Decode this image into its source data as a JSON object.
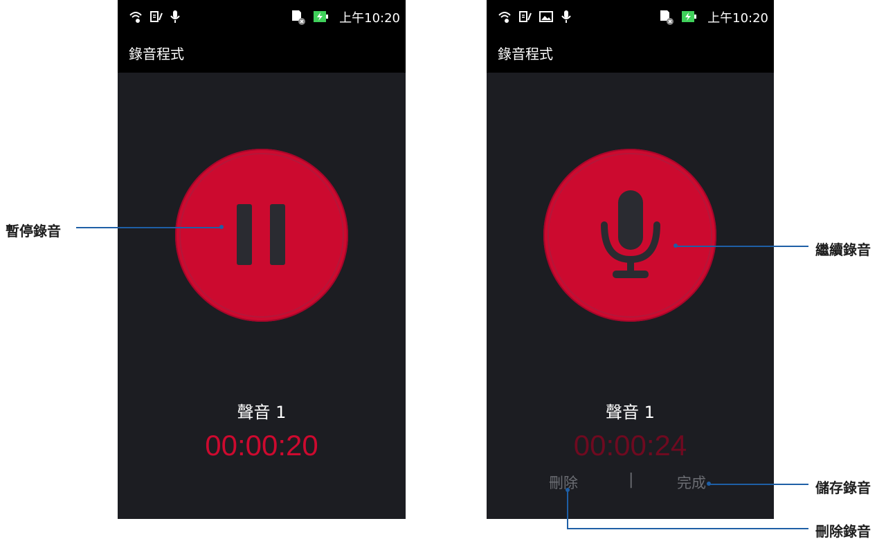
{
  "left_phone": {
    "status_time": "上午10:20",
    "app_title": "錄音程式",
    "recording_name": "聲音 1",
    "timer": "00:00:20"
  },
  "right_phone": {
    "status_time": "上午10:20",
    "app_title": "錄音程式",
    "recording_name": "聲音 1",
    "timer": "00:00:24",
    "delete_label": "刪除",
    "divider": "|",
    "done_label": "完成"
  },
  "callouts": {
    "pause": "暫停錄音",
    "resume": "繼續錄音",
    "save": "儲存錄音",
    "delete": "刪除錄音"
  },
  "colors": {
    "accent_red": "#cc0a2f",
    "callout_blue": "#1e5fa6",
    "app_background": "#1c1d22"
  },
  "icons": {
    "pause_button": "pause-icon",
    "resume_button": "microphone-icon"
  }
}
